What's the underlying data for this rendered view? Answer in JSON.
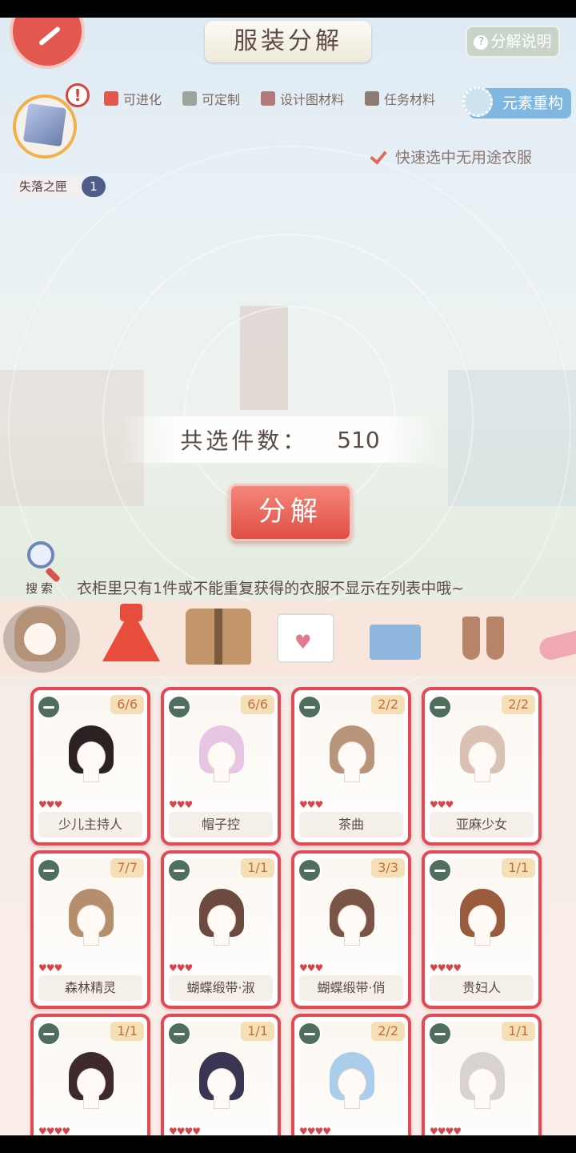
{
  "header": {
    "title": "服装分解",
    "help_label": "分解说明"
  },
  "filters": [
    {
      "label": "可进化",
      "color": "#e2574f"
    },
    {
      "label": "可定制",
      "color": "#9aa69a"
    },
    {
      "label": "设计图材料",
      "color": "#b07a7a"
    },
    {
      "label": "任务材料",
      "color": "#8c7a74"
    }
  ],
  "element_rebuild_label": "元素重构",
  "lost_box": {
    "label": "失落之匣",
    "count": "1"
  },
  "quick_select_label": "快速选中无用途衣服",
  "selected": {
    "label": "共选件数：",
    "value": "510"
  },
  "decompose_label": "分解",
  "search_label": "搜索",
  "notice": "衣柜里只有1件或不能重复获得的衣服不显示在列表中哦~",
  "categories": [
    "hair",
    "dress",
    "coat",
    "top",
    "bottom",
    "socks",
    "shoes"
  ],
  "items": [
    {
      "name": "少儿主持人",
      "qty": "6/6",
      "hearts": "♥♥♥",
      "hair_color": "#2c2224"
    },
    {
      "name": "帽子控",
      "qty": "6/6",
      "hearts": "♥♥♥",
      "hair_color": "#e6c6e4"
    },
    {
      "name": "茶曲",
      "qty": "2/2",
      "hearts": "♥♥♥",
      "hair_color": "#b8957a"
    },
    {
      "name": "亚麻少女",
      "qty": "2/2",
      "hearts": "♥♥♥",
      "hair_color": "#d9c2b4"
    },
    {
      "name": "森林精灵",
      "qty": "7/7",
      "hearts": "♥♥♥",
      "hair_color": "#b58e6e"
    },
    {
      "name": "蝴蝶缎带·淑",
      "qty": "1/1",
      "hearts": "♥♥♥",
      "hair_color": "#6c4a40"
    },
    {
      "name": "蝴蝶缎带·俏",
      "qty": "3/3",
      "hearts": "♥♥♥",
      "hair_color": "#7a5446"
    },
    {
      "name": "贵妇人",
      "qty": "1/1",
      "hearts": "♥♥♥♥",
      "hair_color": "#9a5a3c"
    },
    {
      "name": "",
      "qty": "1/1",
      "hearts": "♥♥♥♥",
      "hair_color": "#3e2a2a"
    },
    {
      "name": "",
      "qty": "1/1",
      "hearts": "♥♥♥♥",
      "hair_color": "#3a3552"
    },
    {
      "name": "",
      "qty": "2/2",
      "hearts": "♥♥♥♥",
      "hair_color": "#a9cdea"
    },
    {
      "name": "",
      "qty": "1/1",
      "hearts": "♥♥♥♥",
      "hair_color": "#d9d2d2"
    }
  ]
}
